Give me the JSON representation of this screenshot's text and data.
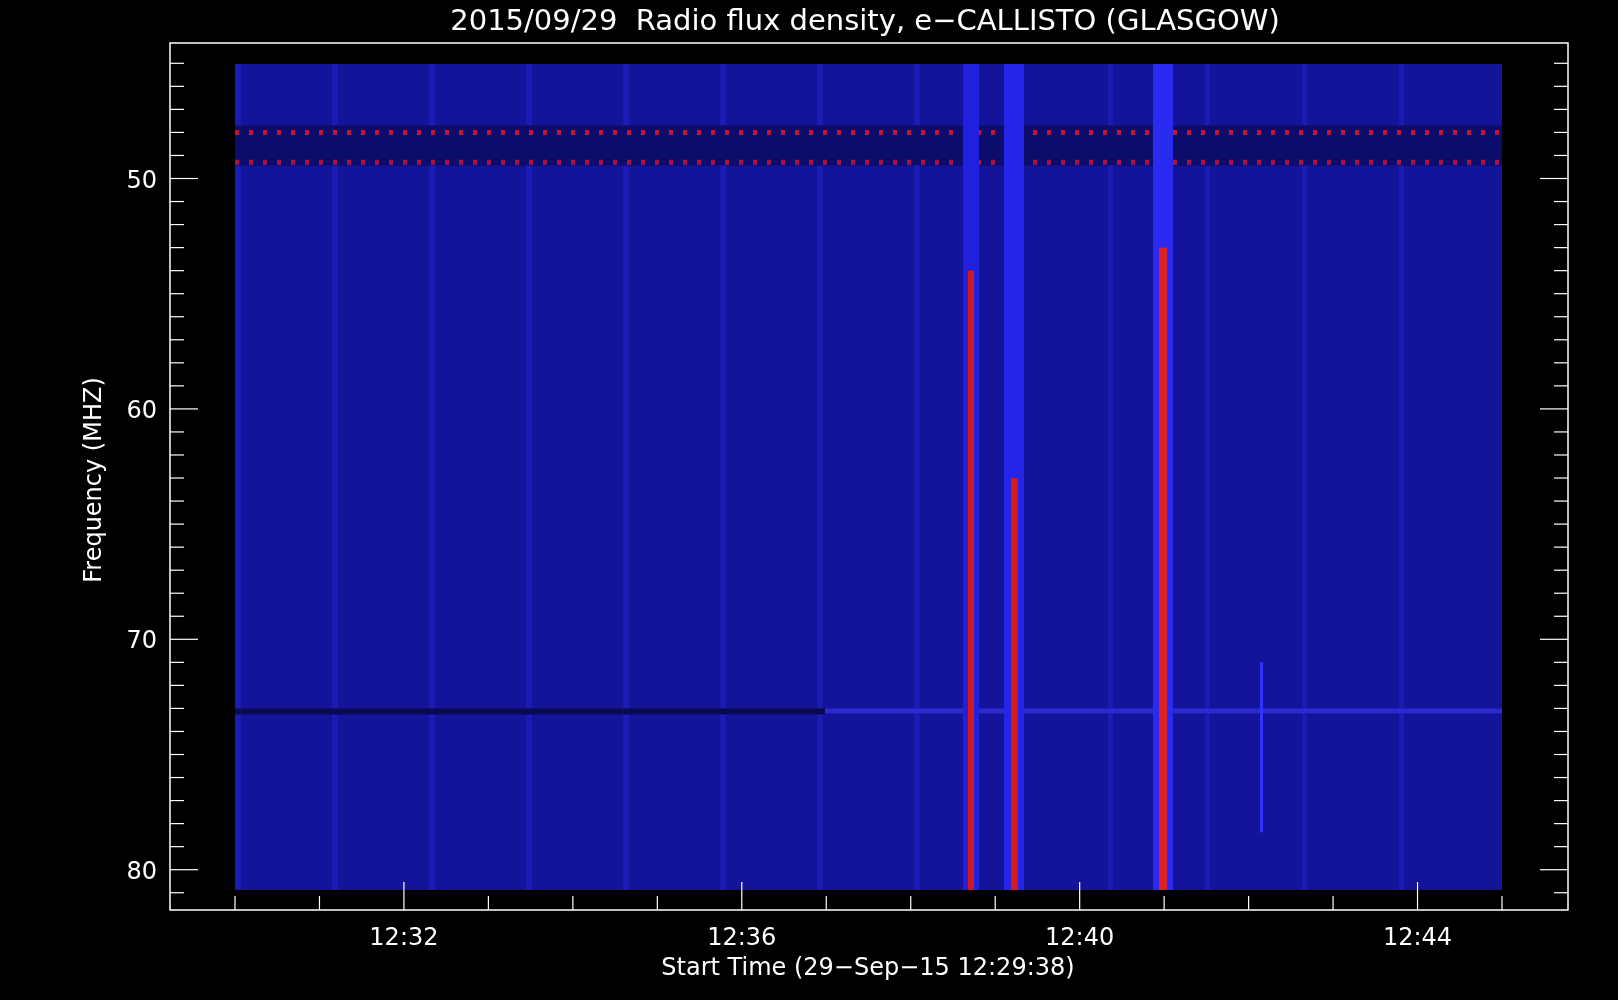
{
  "plot": {
    "title": "2015/09/29  Radio flux density, e−CALLISTO (GLASGOW)",
    "xlabel": "Start Time (29−Sep−15 12:29:38)",
    "ylabel": "Frequency (MHZ)",
    "x_tick_labels": [
      "12:32",
      "12:36",
      "12:40",
      "12:44"
    ],
    "y_tick_labels": [
      "50",
      "60",
      "70",
      "80"
    ]
  }
}
